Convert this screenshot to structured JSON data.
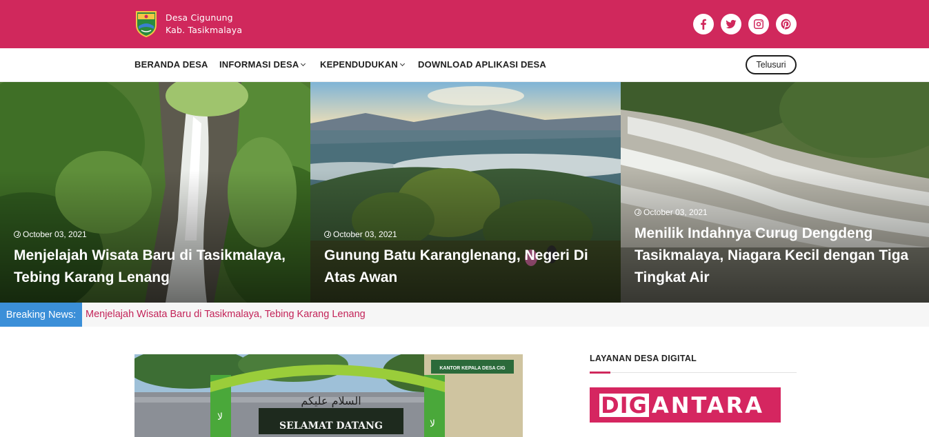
{
  "header": {
    "brand_line1": "Desa Cigunung",
    "brand_line2": "Kab. Tasikmalaya",
    "accent_color": "#d0285c",
    "social": [
      {
        "icon": "facebook-icon"
      },
      {
        "icon": "twitter-icon"
      },
      {
        "icon": "instagram-icon"
      },
      {
        "icon": "pinterest-icon"
      }
    ]
  },
  "nav": {
    "items": [
      {
        "label": "BERANDA DESA",
        "dropdown": false
      },
      {
        "label": "INFORMASI DESA",
        "dropdown": true
      },
      {
        "label": "KEPENDUDUKAN",
        "dropdown": true
      },
      {
        "label": "DOWNLOAD APLIKASI DESA",
        "dropdown": false
      }
    ],
    "search_label": "Telusuri"
  },
  "hero": [
    {
      "date": "October 03, 2021",
      "title": "Menjelajah Wisata Baru di Tasikmalaya, Tebing Karang Lenang"
    },
    {
      "date": "October 03, 2021",
      "title": "Gunung Batu Karanglenang, Negeri Di Atas Awan"
    },
    {
      "date": "October 03, 2021",
      "title": "Menilik Indahnya Curug Dengdeng Tasikmalaya, Niagara Kecil dengan Tiga Tingkat Air"
    }
  ],
  "breaking": {
    "label": "Breaking News:",
    "text": "Menjelajah Wisata Baru di Tasikmalaya, Tebing Karang Lenang",
    "label_color": "#3b8fd8"
  },
  "feature": {
    "arabic_text": "السلام عليكم",
    "gate_text": "SELAMAT DATANG",
    "sign_text": "KANTOR KEPALA DESA CIG"
  },
  "sidebar": {
    "title": "LAYANAN DESA DIGITAL",
    "banner_part1": "DIG",
    "banner_part2": "ANTARA"
  }
}
